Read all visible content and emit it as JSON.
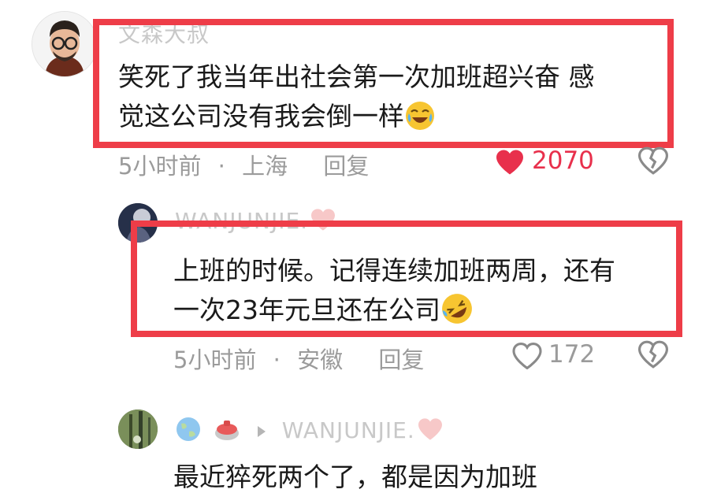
{
  "comments": [
    {
      "username": "文森大叔",
      "lines": [
        "笑死了我当年出社会第一次加班超兴奋 感",
        "觉这公司没有我会倒一样"
      ],
      "time": "5小时前",
      "location": "上海",
      "reply_label": "回复",
      "likes": "2070",
      "liked": true
    },
    {
      "username": "WANJUNJIE.",
      "lines": [
        "上班的时候。记得连续加班两周，还有",
        "一次23年元旦还在公司"
      ],
      "time": "5小时前",
      "location": "安徽",
      "reply_label": "回复",
      "likes": "172",
      "liked": false
    },
    {
      "username": "WANJUNJIE.",
      "lines": [
        "最近猝死两个了，都是因为加班"
      ]
    }
  ],
  "separator": "·",
  "colors": {
    "highlight_border": "#ee3d48",
    "like_active": "#e8304c",
    "meta_gray": "#9b9b9b",
    "username_gray": "#c8c8c8"
  },
  "icons": [
    "crying-laughing-emoji",
    "rolling-laughing-emoji",
    "heart-icon",
    "broken-heart-icon",
    "play-arrow-icon",
    "earth-badge-icon",
    "curling-stone-badge-icon",
    "pink-heart-icon"
  ]
}
